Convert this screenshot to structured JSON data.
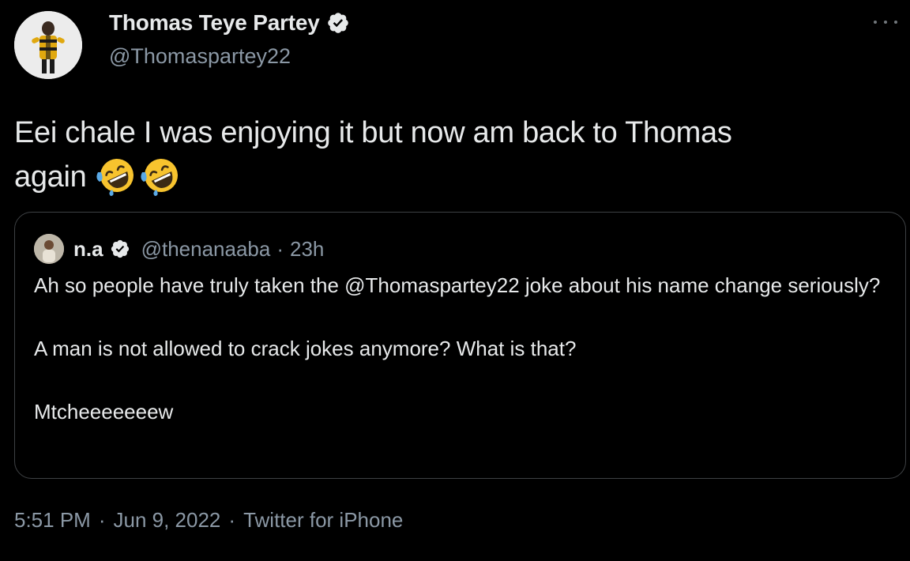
{
  "author": {
    "display_name": "Thomas Teye Partey",
    "handle": "@Thomaspartey22",
    "verified": true
  },
  "tweet": {
    "text_line1": "Eei chale I was enjoying it but now am back to Thomas",
    "text_line2": "again",
    "emojis": [
      "rolling-on-floor-laughing-icon",
      "rolling-on-floor-laughing-icon"
    ]
  },
  "quoted": {
    "display_name": "n.a",
    "handle": "@thenanaaba",
    "separator": "·",
    "time": "23h",
    "verified": true,
    "para1_before": "Ah so people have truly taken the ",
    "para1_mention": "@Thomaspartey22",
    "para1_after": " joke about his name change seriously?",
    "para2": "A man is not allowed to crack jokes anymore? What is that?",
    "para3": "Mtcheeeeeeew"
  },
  "meta": {
    "time": "5:51 PM",
    "sep1": "·",
    "date": "Jun 9, 2022",
    "sep2": "·",
    "source": "Twitter for iPhone"
  },
  "colors": {
    "background": "#000000",
    "text": "#e7e9ea",
    "secondary": "#8b98a5",
    "border": "#3e4144",
    "verified_badge": "#e7e9ea"
  }
}
